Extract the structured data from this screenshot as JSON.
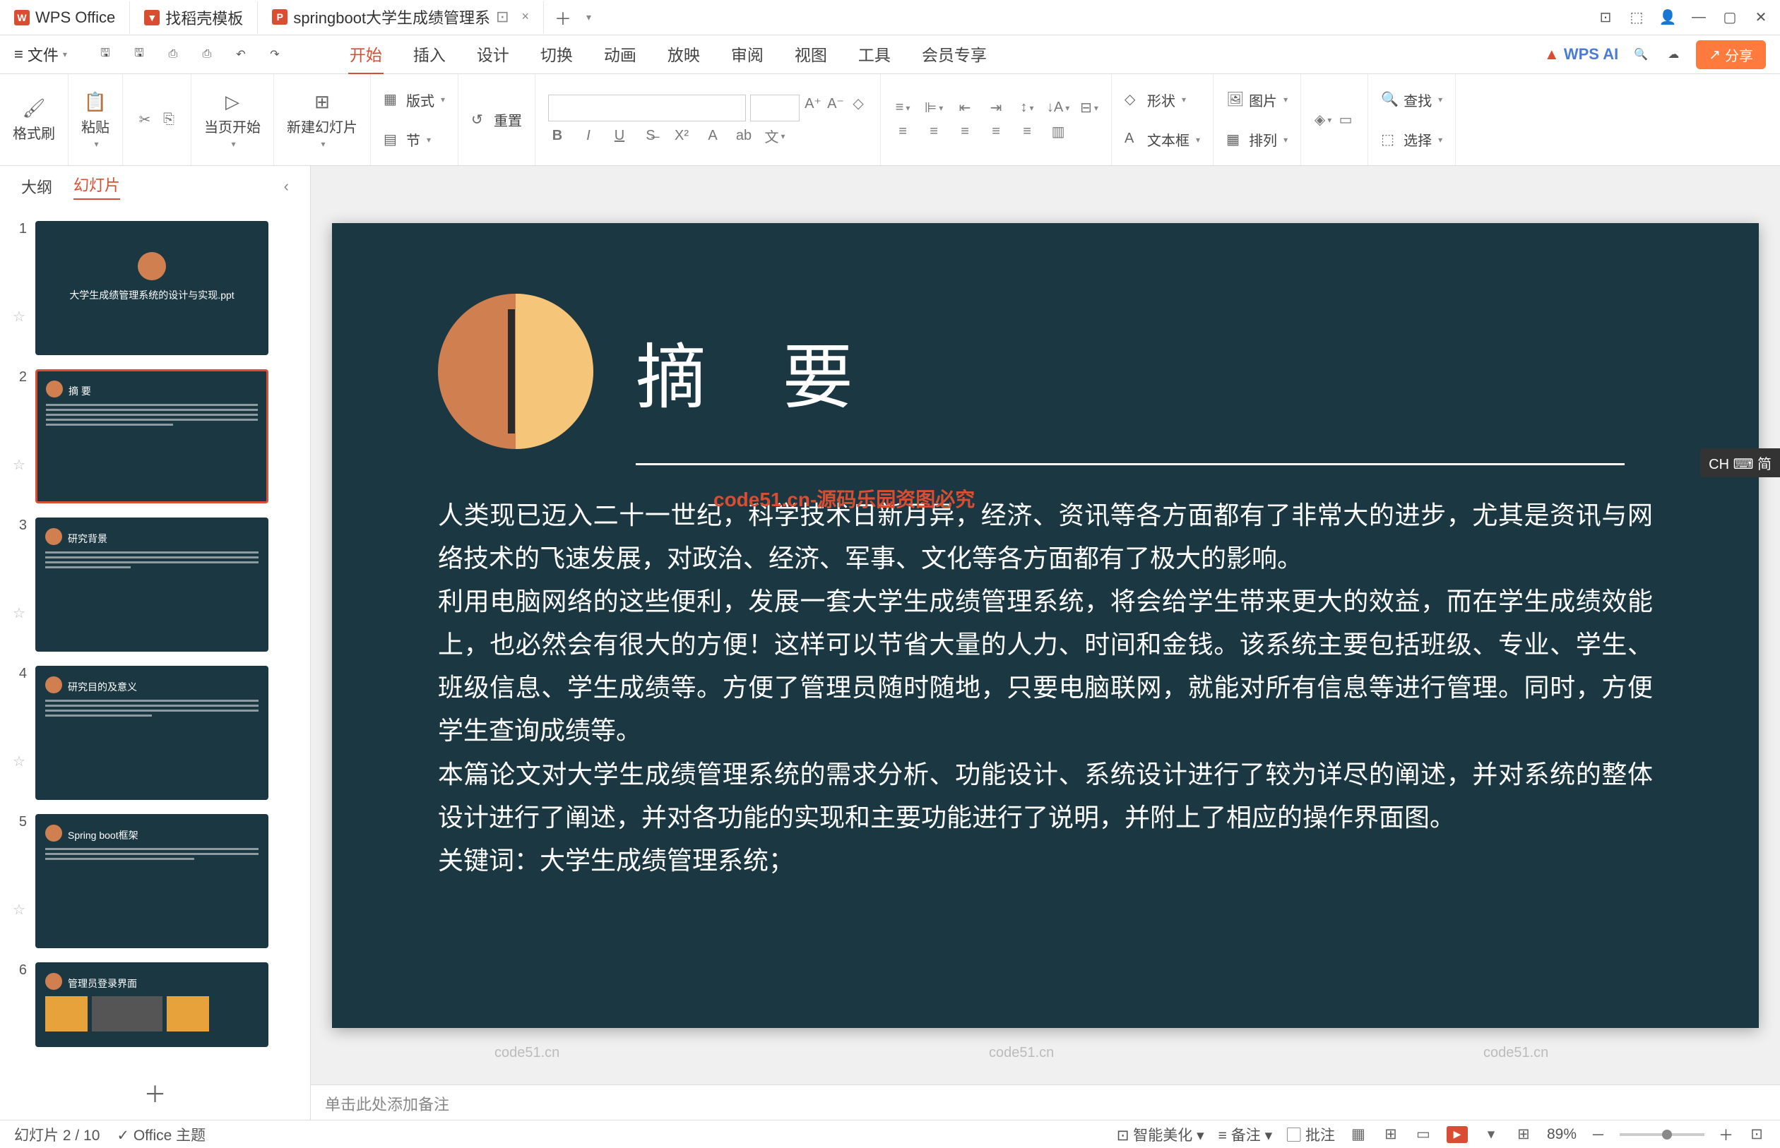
{
  "titlebar": {
    "tabs": [
      {
        "icon": "W",
        "label": "WPS Office"
      },
      {
        "icon": "▼",
        "label": "找稻壳模板"
      },
      {
        "icon": "P",
        "label": "springboot大学生成绩管理系",
        "active": true
      }
    ],
    "add": "＋"
  },
  "menubar": {
    "file": "文件",
    "tabs": [
      "开始",
      "插入",
      "设计",
      "切换",
      "动画",
      "放映",
      "审阅",
      "视图",
      "工具",
      "会员专享"
    ],
    "active": "开始",
    "wpsai": "WPS AI",
    "share": "分享"
  },
  "ribbon": {
    "format_brush": "格式刷",
    "paste": "粘贴",
    "from_current": "当页开始",
    "new_slide": "新建幻灯片",
    "layout": "版式",
    "section": "节",
    "reset": "重置",
    "text": "文",
    "shape": "形状",
    "picture": "图片",
    "textbox": "文本框",
    "arrange": "排列",
    "find": "查找",
    "select": "选择"
  },
  "slidepane": {
    "tab_outline": "大纲",
    "tab_slides": "幻灯片",
    "slides": [
      {
        "num": "1",
        "title": "大学生成绩管理系统的设计与实现.ppt"
      },
      {
        "num": "2",
        "title": "摘 要",
        "selected": true
      },
      {
        "num": "3",
        "title": "研究背景"
      },
      {
        "num": "4",
        "title": "研究目的及意义"
      },
      {
        "num": "5",
        "title": "Spring boot框架"
      },
      {
        "num": "6",
        "title": "管理员登录界面"
      }
    ],
    "add": "＋"
  },
  "slide": {
    "title": "摘 要",
    "body1": "人类现已迈入二十一世纪，科学技术日新月异，经济、资讯等各方面都有了非常大的进步，尤其是资讯与网络技术的飞速发展，对政治、经济、军事、文化等各方面都有了极大的影响。",
    "body2": "利用电脑网络的这些便利，发展一套大学生成绩管理系统，将会给学生带来更大的效益，而在学生成绩效能上，也必然会有很大的方便！这样可以节省大量的人力、时间和金钱。该系统主要包括班级、专业、学生、班级信息、学生成绩等。方便了管理员随时随地，只要电脑联网，就能对所有信息等进行管理。同时，方便学生查询成绩等。",
    "body3": "本篇论文对大学生成绩管理系统的需求分析、功能设计、系统设计进行了较为详尽的阐述，并对系统的整体设计进行了阐述，并对各功能的实现和主要功能进行了说明，并附上了相应的操作界面图。",
    "body4": "关键词：大学生成绩管理系统；"
  },
  "notes": {
    "placeholder": "单击此处添加备注"
  },
  "ime": "CH ⌨ 简",
  "watermark_red": "code51.cn-源码乐园资图必究",
  "statusbar": {
    "slide_pos": "幻灯片 2 / 10",
    "theme": "Office 主题",
    "beautify": "智能美化",
    "notes_btn": "备注",
    "review": "批注",
    "zoom": "89%"
  }
}
